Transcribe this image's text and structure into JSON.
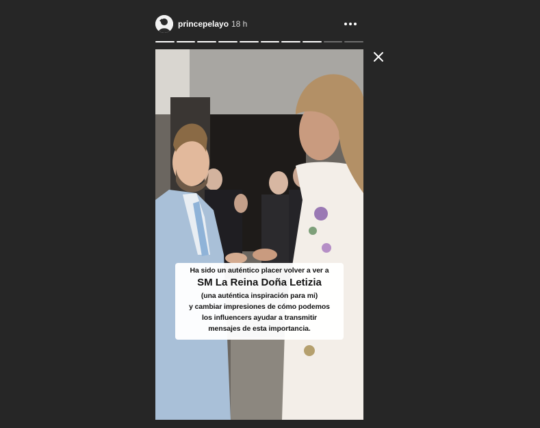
{
  "story": {
    "username": "princepelayo",
    "timestamp": "18 h",
    "progress_segments": 10,
    "progress_viewed": 8,
    "caption": {
      "line1": "Ha sido un auténtico placer volver a ver a",
      "line2": "SM La Reina Doña Letizia",
      "line3": "(una auténtica inspiración para mi)",
      "line4": "y cambiar impresiones de cómo podemos",
      "line5": "los influencers ayudar a transmitir",
      "line6": "mensajes de esta importancia."
    }
  },
  "icons": {
    "more": "more-horizontal-icon",
    "close": "close-icon"
  },
  "colors": {
    "background": "#262626",
    "progress_viewed": "#ffffff",
    "progress_pending": "#6e6e6e",
    "caption_bg": "#ffffff",
    "text": "#ffffff"
  }
}
